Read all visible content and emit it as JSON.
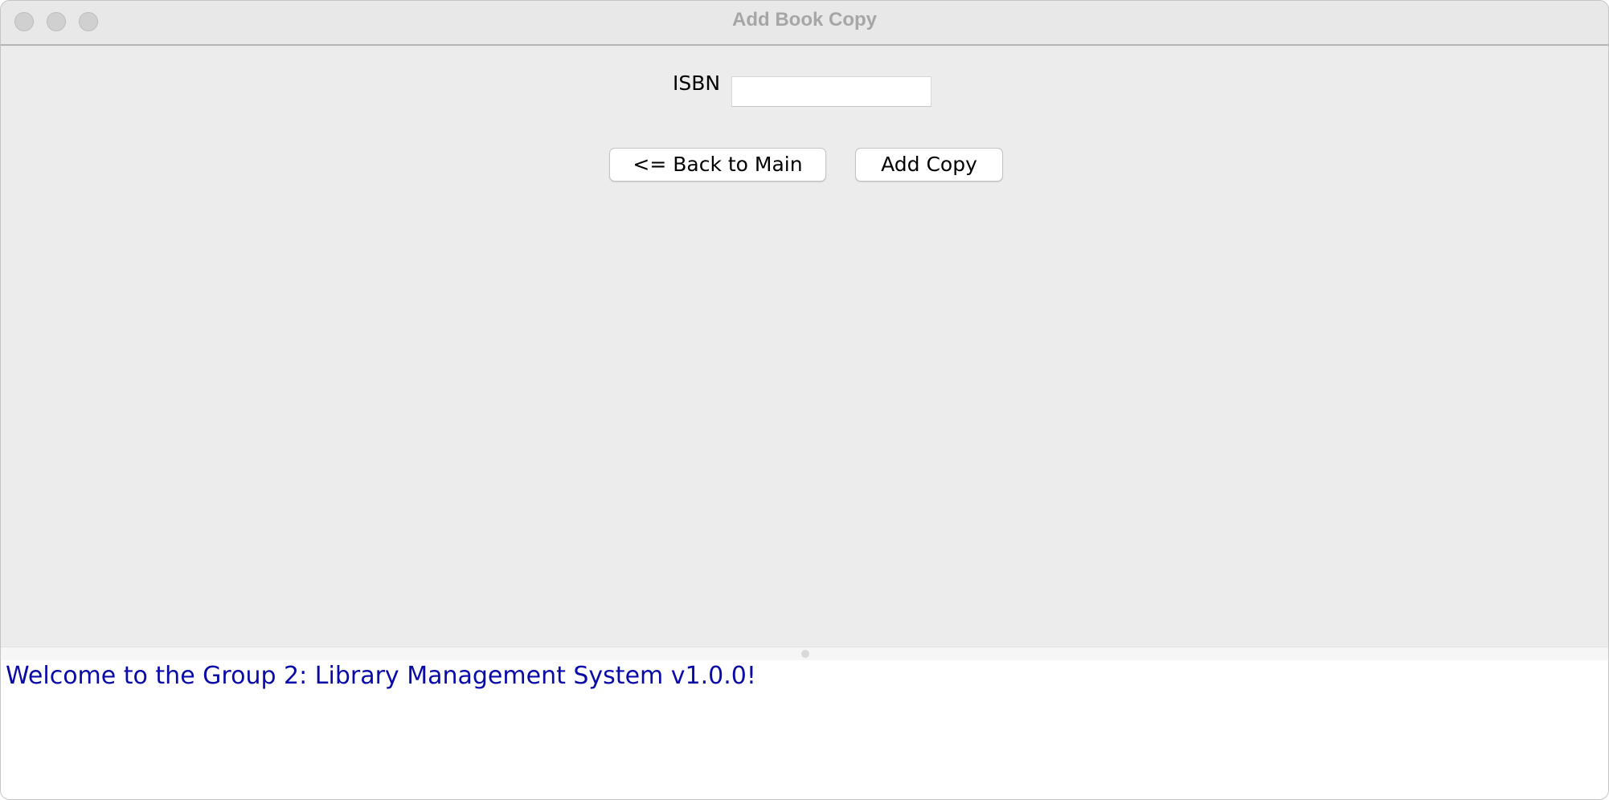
{
  "window": {
    "title": "Add Book Copy"
  },
  "form": {
    "isbn_label": "ISBN",
    "isbn_value": "",
    "isbn_placeholder": ""
  },
  "buttons": {
    "back_label": "<= Back to Main",
    "add_copy_label": "Add Copy"
  },
  "console": {
    "message": "Welcome to the Group 2: Library Management System v1.0.0!",
    "message_color": "#0a0aa8"
  },
  "colors": {
    "window_background": "#ececec",
    "title_text": "#a6a6a6",
    "traffic_lights_inactive": "#d0d0d0"
  }
}
